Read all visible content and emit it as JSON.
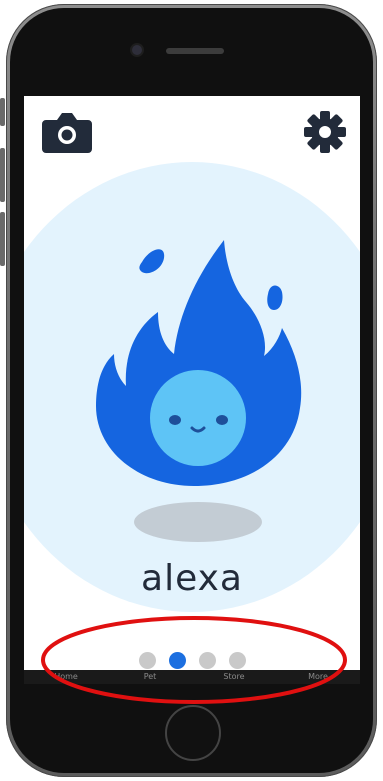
{
  "toolbar": {
    "camera_icon": "camera-icon",
    "settings_icon": "gear-icon"
  },
  "mascot": {
    "name": "alexa",
    "icon": "flame-character"
  },
  "pagination": {
    "total": 4,
    "active_index": 1
  },
  "bottom_tabs": [
    "Home",
    "Pet",
    "Store",
    "More"
  ],
  "colors": {
    "accent": "#1c6fe0",
    "flame": "#1565e0",
    "face": "#5ec4f6",
    "background_circle": "#e3f3fd",
    "highlight_ring": "#e01010",
    "text": "#222b3a"
  }
}
